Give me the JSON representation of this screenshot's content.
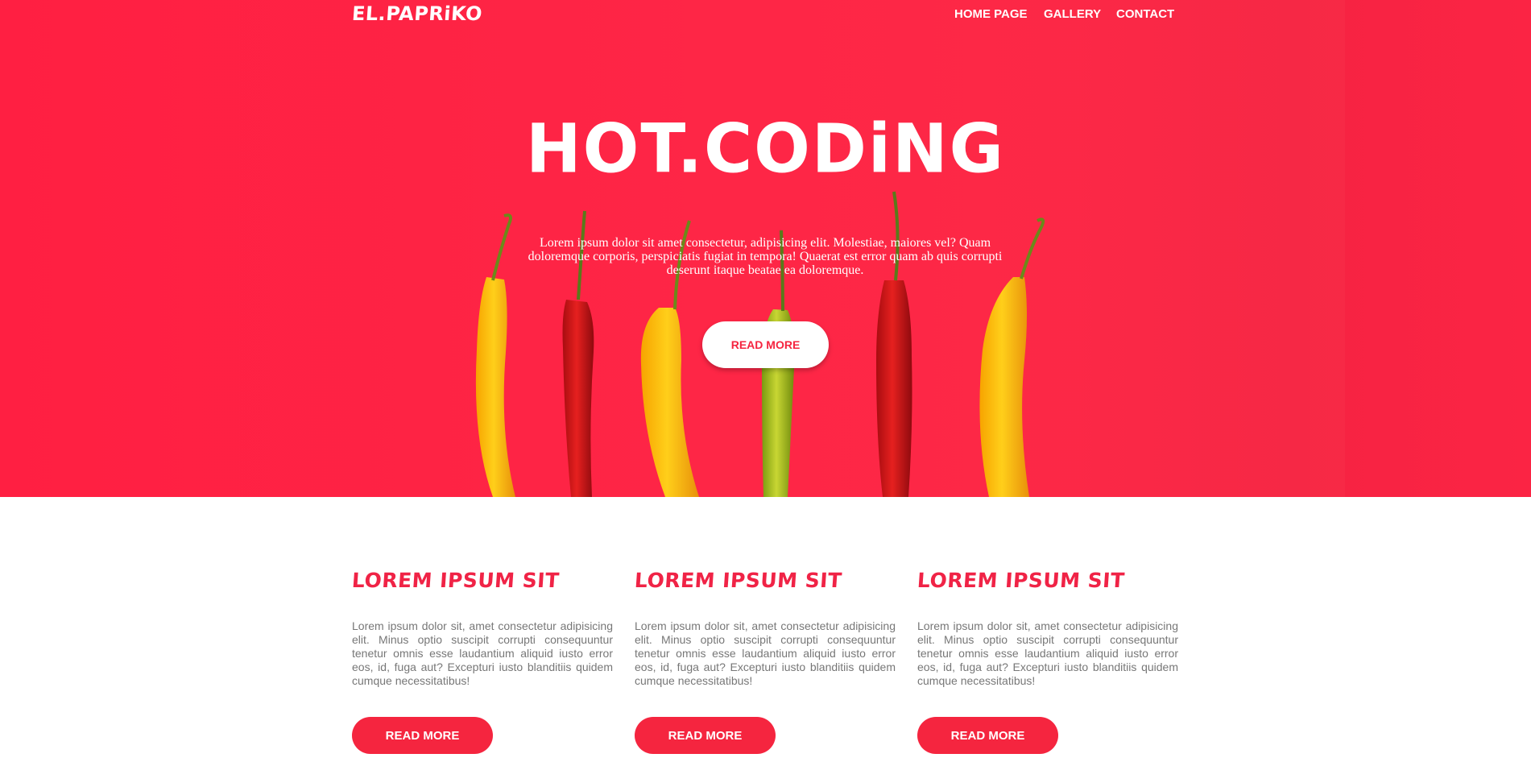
{
  "brand": {
    "logo": "EL.PAPRiKO"
  },
  "nav": {
    "items": [
      "HOME PAGE",
      "GALLERY",
      "CONTACT"
    ]
  },
  "hero": {
    "title": "HOT.CODiNG",
    "description": "Lorem ipsum dolor sit amet consectetur, adipisicing elit. Molestiae, maiores vel? Quam doloremque corporis, perspiciatis fugiat in tempora! Quaerat est error quam ab quis corrupti deserunt itaque beatae ea doloremque.",
    "button": "READ MORE"
  },
  "cards": [
    {
      "title": "LOREM IPSUM SIT",
      "text": "Lorem ipsum dolor sit, amet consectetur adipisicing elit. Minus optio suscipit corrupti consequuntur tenetur omnis esse laudantium aliquid iusto error eos, id, fuga aut? Excepturi iusto blanditiis quidem cumque necessitatibus!",
      "button": "READ MORE"
    },
    {
      "title": "LOREM IPSUM SIT",
      "text": "Lorem ipsum dolor sit, amet consectetur adipisicing elit. Minus optio suscipit corrupti consequuntur tenetur omnis esse laudantium aliquid iusto error eos, id, fuga aut? Excepturi iusto blanditiis quidem cumque necessitatibus!",
      "button": "READ MORE"
    },
    {
      "title": "LOREM IPSUM SIT",
      "text": "Lorem ipsum dolor sit, amet consectetur adipisicing elit. Minus optio suscipit corrupti consequuntur tenetur omnis esse laudantium aliquid iusto error eos, id, fuga aut? Excepturi iusto blanditiis quidem cumque necessitatibus!",
      "button": "READ MORE"
    }
  ],
  "colors": {
    "accent": "#f5253f",
    "hero_bg": "#fe2646",
    "heading": "#f02346",
    "body_text": "#777777"
  }
}
